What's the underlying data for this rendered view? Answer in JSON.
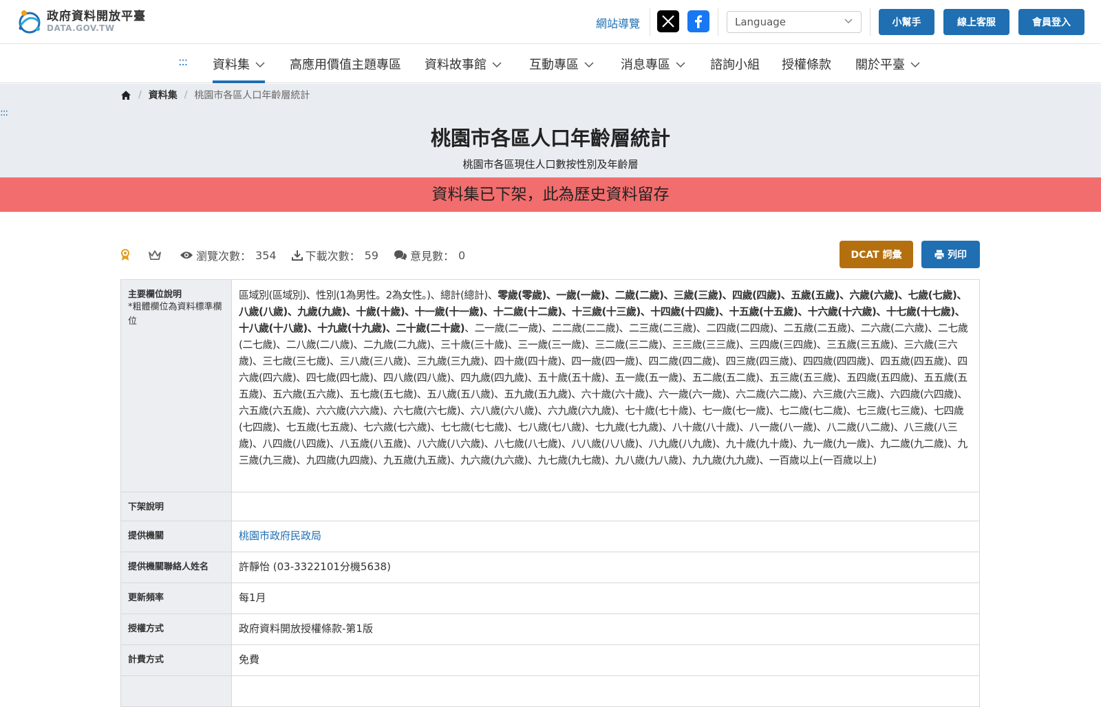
{
  "header": {
    "logo_title": "政府資料開放平臺",
    "logo_subtitle": "DATA.GOV.TW",
    "site_map": "網站導覽",
    "language_placeholder": "Language",
    "buttons": [
      "小幫手",
      "線上客服",
      "會員登入"
    ],
    "colors": {
      "primary": "#1f6fb2",
      "facebook": "#1877f2",
      "x": "#000000"
    }
  },
  "nav": {
    "accesskey": ":::",
    "items": [
      {
        "label": "資料集",
        "dropdown": true,
        "active": true
      },
      {
        "label": "高應用價值主題專區",
        "dropdown": false
      },
      {
        "label": "資料故事館",
        "dropdown": true
      },
      {
        "label": "互動專區",
        "dropdown": true
      },
      {
        "label": "消息專區",
        "dropdown": true
      },
      {
        "label": "諮詢小組",
        "dropdown": false
      },
      {
        "label": "授權條款",
        "dropdown": false
      },
      {
        "label": "關於平臺",
        "dropdown": true
      }
    ]
  },
  "breadcrumb": {
    "home_icon": "home-icon",
    "items": [
      "資料集",
      "桃園市各區人口年齡層統計"
    ]
  },
  "hero": {
    "accesskey": ":::",
    "title": "桃園市各區人口年齡層統計",
    "subtitle": "桃園市各區現住人口數按性別及年齡層",
    "banner": "資料集已下架，此為歷史資料留存",
    "banner_color": "#f26d6d"
  },
  "stats": {
    "views_label": "瀏覽次數：",
    "views": "354",
    "downloads_label": "下載次數：",
    "downloads": "59",
    "comments_label": "意見數：",
    "comments": "0"
  },
  "actions": {
    "dcat": "DCAT 詞彙",
    "print": "列印",
    "dcat_color": "#b4700e"
  },
  "table": {
    "fields_label": "主要欄位說明",
    "fields_note": "*粗體欄位為資料標準欄位",
    "fields_plain_head": "區域別(區域別)、性別(1為男性。2為女性。)、總計(總計)、",
    "fields_bold": "零歲(零歲)、一歲(一歲)、二歲(二歲)、三歲(三歲)、四歲(四歲)、五歲(五歲)、六歲(六歲)、七歲(七歲)、八歲(八歲)、九歲(九歲)、十歲(十歲)、十一歲(十一歲)、十二歲(十二歲)、十三歲(十三歲)、十四歲(十四歲)、十五歲(十五歲)、十六歲(十六歲)、十七歲(十七歲)、十八歲(十八歲)、十九歲(十九歲)、二十歲(二十歲)",
    "fields_rest": "、二一歲(二一歲)、二二歲(二二歲)、二三歲(二三歲)、二四歲(二四歲)、二五歲(二五歲)、二六歲(二六歲)、二七歲(二七歲)、二八歲(二八歲)、二九歲(二九歲)、三十歲(三十歲)、三一歲(三一歲)、三二歲(三二歲)、三三歲(三三歲)、三四歲(三四歲)、三五歲(三五歲)、三六歲(三六歲)、三七歲(三七歲)、三八歲(三八歲)、三九歲(三九歲)、四十歲(四十歲)、四一歲(四一歲)、四二歲(四二歲)、四三歲(四三歲)、四四歲(四四歲)、四五歲(四五歲)、四六歲(四六歲)、四七歲(四七歲)、四八歲(四八歲)、四九歲(四九歲)、五十歲(五十歲)、五一歲(五一歲)、五二歲(五二歲)、五三歲(五三歲)、五四歲(五四歲)、五五歲(五五歲)、五六歲(五六歲)、五七歲(五七歲)、五八歲(五八歲)、五九歲(五九歲)、六十歲(六十歲)、六一歲(六一歲)、六二歲(六二歲)、六三歲(六三歲)、六四歲(六四歲)、六五歲(六五歲)、六六歲(六六歲)、六七歲(六七歲)、六八歲(六八歲)、六九歲(六九歲)、七十歲(七十歲)、七一歲(七一歲)、七二歲(七二歲)、七三歲(七三歲)、七四歲(七四歲)、七五歲(七五歲)、七六歲(七六歲)、七七歲(七七歲)、七八歲(七八歲)、七九歲(七九歲)、八十歲(八十歲)、八一歲(八一歲)、八二歲(八二歲)、八三歲(八三歲)、八四歲(八四歲)、八五歲(八五歲)、八六歲(八六歲)、八七歲(八七歲)、八八歲(八八歲)、八九歲(八九歲)、九十歲(九十歲)、九一歲(九一歲)、九二歲(九二歲)、九三歲(九三歲)、九四歲(九四歲)、九五歲(九五歲)、九六歲(九六歲)、九七歲(九七歲)、九八歲(九八歲)、九九歲(九九歲)、一百歲以上(一百歲以上)",
    "delist_label": "下架說明",
    "delist_value": "",
    "agency_label": "提供機關",
    "agency_value": "桃園市政府民政局",
    "contact_label": "提供機關聯絡人姓名",
    "contact_value": "許靜怡 (03-3322101分機5638)",
    "frequency_label": "更新頻率",
    "frequency_value": "每1月",
    "license_label": "授權方式",
    "license_value": "政府資料開放授權條款-第1版",
    "fee_label": "計費方式",
    "fee_value": "免費"
  }
}
